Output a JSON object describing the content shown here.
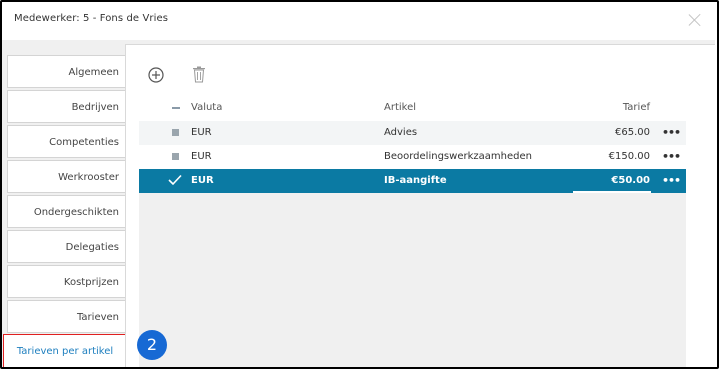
{
  "dialog": {
    "title": "Medewerker: 5 - Fons de Vries"
  },
  "sidebar": {
    "items": [
      {
        "label": "Algemeen"
      },
      {
        "label": "Bedrijven"
      },
      {
        "label": "Competenties"
      },
      {
        "label": "Werkrooster"
      },
      {
        "label": "Ondergeschikten"
      },
      {
        "label": "Delegaties"
      },
      {
        "label": "Kostprijzen"
      },
      {
        "label": "Tarieven"
      },
      {
        "label": "Tarieven per artikel"
      }
    ]
  },
  "toolbar": {
    "add_icon": "plus-circle-icon",
    "delete_icon": "trash-icon"
  },
  "table": {
    "columns": {
      "currency": "Valuta",
      "article": "Artikel",
      "rate": "Tarief"
    },
    "rows": [
      {
        "currency": "EUR",
        "article": "Advies",
        "rate": "€65.00",
        "selected": false
      },
      {
        "currency": "EUR",
        "article": "Beoordelingswerkzaamheden",
        "rate": "€150.00",
        "selected": false
      },
      {
        "currency": "EUR",
        "article": "IB-aangifte",
        "rate": "€50.00",
        "selected": true
      }
    ]
  },
  "step_badge": {
    "label": "2"
  },
  "colors": {
    "selected_row": "#0b7aa3",
    "badge": "#1769d4",
    "highlight_border": "#e02020",
    "link": "#1e7fbf"
  }
}
